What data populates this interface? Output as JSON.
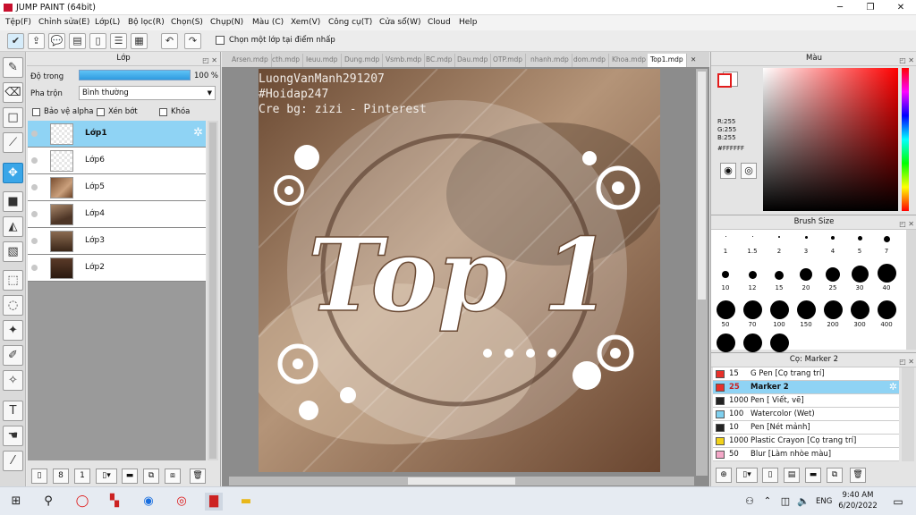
{
  "window": {
    "title": "JUMP PAINT (64bit)"
  },
  "menu": [
    "Tệp(F)",
    "Chỉnh sửa(E)",
    "Lớp(L)",
    "Bộ lọc(R)",
    "Chọn(S)",
    "Chụp(N)",
    "Màu (C)",
    "Xem(V)",
    "Công cụ(T)",
    "Cửa sổ(W)",
    "Cloud",
    "Help"
  ],
  "toolbar": {
    "pick_layer_label": "Chọn một lớp tại điểm nhấp"
  },
  "layer_panel": {
    "title": "Lớp",
    "opacity_label": "Độ trong",
    "opacity_value": "100 %",
    "opacity_fraction": 1.0,
    "blend_label": "Pha trộn",
    "blend_value": "Bình thường",
    "protect_alpha": "Bảo vệ alpha",
    "clipping": "Xén bớt",
    "lock": "Khóa",
    "layers": [
      {
        "name": "Lớp1",
        "selected": true
      },
      {
        "name": "Lớp6"
      },
      {
        "name": "Lớp5"
      },
      {
        "name": "Lớp4"
      },
      {
        "name": "Lớp3"
      },
      {
        "name": "Lớp2"
      }
    ]
  },
  "document_tabs": [
    "Arsen.mdp",
    "cth.mdp",
    "Ieuu.mdp",
    "Dung.mdp",
    "Vsmb.mdp",
    "BC.mdp",
    "Dau.mdp",
    "OTP.mdp",
    "nhanh.mdp",
    "dom.mdp",
    "Khoa.mdp",
    "Top1.mdp"
  ],
  "active_tab": "Top1.mdp",
  "artwork": {
    "line1": "LuongVanManh291207",
    "line2": "#Hoidap247",
    "line3": "Cre bg: zizi - Pinterest",
    "title": "Top 1"
  },
  "color_panel": {
    "title": "Màu",
    "r": "R:255",
    "g": "G:255",
    "b": "B:255",
    "hex": "#FFFFFF"
  },
  "brush_panel": {
    "title": "Brush Size",
    "sizes": [
      "1",
      "1.5",
      "2",
      "3",
      "4",
      "5",
      "7",
      "10",
      "12",
      "15",
      "20",
      "25",
      "30",
      "40",
      "50",
      "70",
      "100",
      "150",
      "200",
      "300",
      "400"
    ]
  },
  "brush_list": {
    "title": "Cọ: Marker 2",
    "items": [
      {
        "size": "15",
        "name": "G Pen [Cọ trang trí]",
        "color": "#e8302a"
      },
      {
        "size": "25",
        "name": "Marker 2",
        "color": "#e8302a",
        "selected": true
      },
      {
        "size": "1000",
        "name": "Pen [ Viết, vẽ]",
        "color": "#222222"
      },
      {
        "size": "100",
        "name": "Watercolor (Wet)",
        "color": "#7fd0ef"
      },
      {
        "size": "10",
        "name": "Pen [Nét mảnh]",
        "color": "#222222"
      },
      {
        "size": "1000",
        "name": "Plastic Crayon [Cọ trang trí]",
        "color": "#f2d21a"
      },
      {
        "size": "50",
        "name": "Blur [Làm nhòe màu]",
        "color": "#f4a8c8"
      }
    ]
  },
  "taskbar": {
    "language": "ENG",
    "time": "9:40 AM",
    "date": "6/20/2022"
  }
}
